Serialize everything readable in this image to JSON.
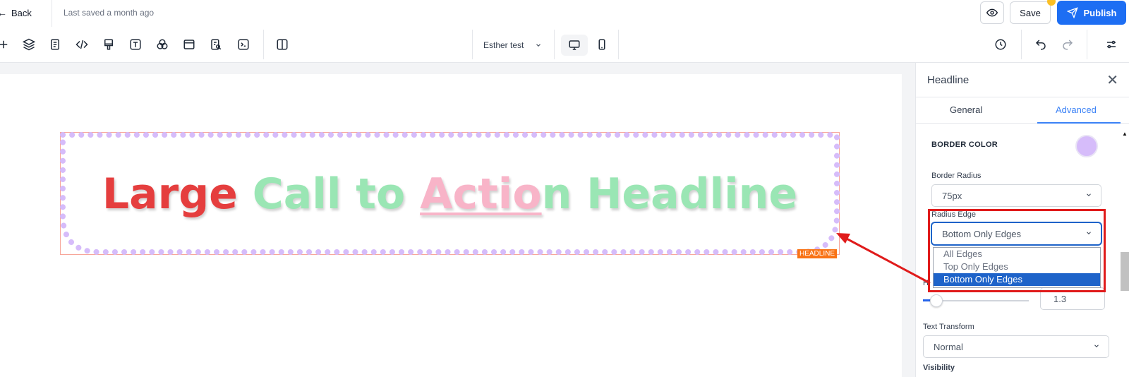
{
  "topbar": {
    "back_label": "Back",
    "saved_status": "Last saved a month ago",
    "save_label": "Save",
    "publish_label": "Publish"
  },
  "toolbar": {
    "page_select": "Esther test",
    "icons": [
      "plus-icon",
      "layers-icon",
      "page-icon",
      "code-icon",
      "paint-icon",
      "text-icon",
      "elements-icon",
      "section-icon",
      "seo-icon",
      "terminal-icon",
      "columns-icon"
    ]
  },
  "canvas": {
    "headline_parts": [
      "Large ",
      "Call to ",
      "Actio",
      "n Headline"
    ],
    "element_tag": "HEADLINE",
    "colors": {
      "red": "#e53e3e",
      "green": "#9ae6b4",
      "pink": "#f8b4c8",
      "border_dots": "#d6bcfa"
    }
  },
  "panel": {
    "title": "Headline",
    "tabs": [
      "General",
      "Advanced"
    ],
    "active_tab": "Advanced",
    "border_color_label": "BORDER COLOR",
    "border_color": "#d6bcfa",
    "border_radius_label": "Border Radius",
    "border_radius_value": "75px",
    "radius_edge_label": "Radius Edge",
    "radius_edge_value": "Bottom Only Edges",
    "radius_edge_options": [
      "All Edges",
      "Top Only Edges",
      "Bottom Only Edges"
    ],
    "line_height_value": "1.3",
    "line_height_fraction": 0.06,
    "text_transform_label": "Text Transform",
    "text_transform_value": "Normal",
    "visibility_label": "Visibility"
  }
}
